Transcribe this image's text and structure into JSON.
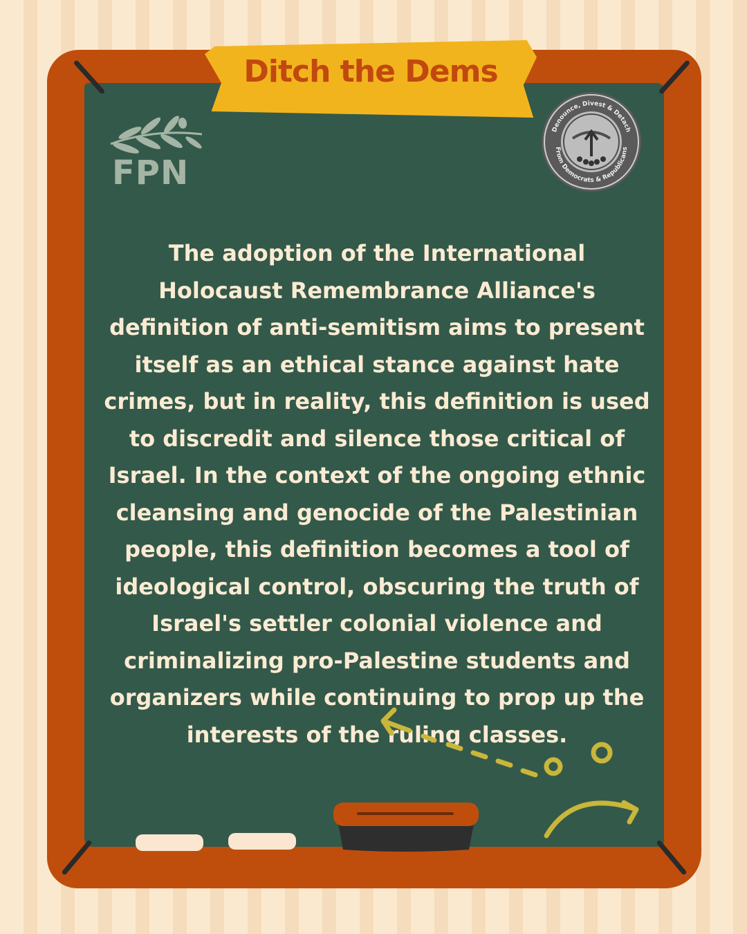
{
  "banner": {
    "title": "Ditch the Dems"
  },
  "logos": {
    "left": {
      "text": "FPN",
      "icon": "olive-branch-icon"
    },
    "right": {
      "icon": "ddd-seal-icon",
      "ring_top": "Denounce, Divest & Detach",
      "ring_bottom": "From Democrats & Republicans"
    }
  },
  "body": {
    "paragraph": "The adoption of the International Holocaust Remembrance Alliance's definition of anti-semitism aims to present itself as an ethical stance against hate crimes, but in reality, this definition is used to discredit and silence those critical of Israel. In the context of the ongoing ethnic cleansing and genocide of the Palestinian people, this definition becomes a tool of ideological control, obscuring the truth of Israel's settler colonial violence and criminalizing pro-Palestine students and organizers while continuing to prop up the interests of the ruling classes."
  },
  "colors": {
    "background_stripe_light": "#fbe9cf",
    "background_stripe_dark": "#f4dcbc",
    "frame": "#bf4e0c",
    "board": "#33594a",
    "banner": "#f2b41d",
    "banner_text": "#c1480f",
    "body_text": "#fbebd3",
    "chalk_doodle": "#c9b63a"
  }
}
